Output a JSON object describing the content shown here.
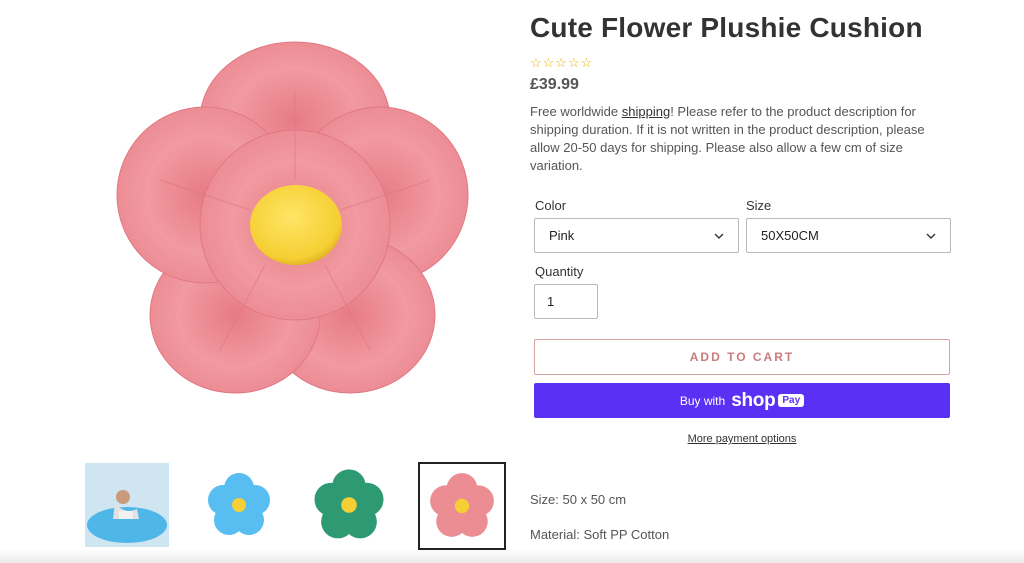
{
  "product": {
    "title": "Cute Flower Plushie Cushion",
    "rating_stars": "☆☆☆☆☆",
    "price": "£39.99",
    "description_prefix": "Free worldwide ",
    "description_link": "shipping",
    "description_suffix": "! Please refer to the product description for shipping duration. If it is not written in the product description, please allow 20-50 days for shipping. Please also allow a few cm of size variation."
  },
  "options": {
    "color_label": "Color",
    "color_value": "Pink",
    "size_label": "Size",
    "size_value": "50X50CM",
    "quantity_label": "Quantity",
    "quantity_value": "1"
  },
  "actions": {
    "add_to_cart": "ADD TO CART",
    "buy_with": "Buy with",
    "shop_brand": "shop",
    "pay_badge": "Pay",
    "more_payment": "More payment options"
  },
  "specs": {
    "size": "Size: 50 x 50 cm",
    "material": "Material: Soft PP Cotton"
  },
  "thumbnails": [
    {
      "name": "blue-flower-with-child",
      "color": "#4fb6e8",
      "active": false
    },
    {
      "name": "blue-flower",
      "color": "#58bdf0",
      "active": false
    },
    {
      "name": "green-flower",
      "color": "#2e9a73",
      "active": false
    },
    {
      "name": "pink-flower",
      "color": "#ec8c93",
      "active": true
    }
  ],
  "colors": {
    "petal_pink": "#ef8d92",
    "center_yellow": "#f5cf33",
    "buy_button": "#5a31f4",
    "add_to_cart_text": "#c97c7c",
    "star": "#e8b400"
  },
  "icons": {
    "select_chevron": "chevron-down-icon"
  }
}
